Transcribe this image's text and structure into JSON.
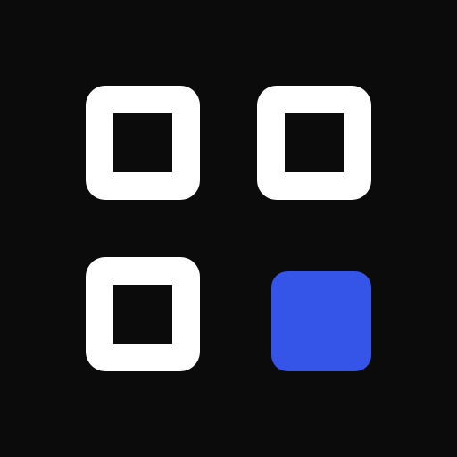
{
  "icon": {
    "name": "app-grid-icon",
    "colors": {
      "background": "#0b0b0c",
      "outline": "#ffffff",
      "accent": "#3554e8"
    },
    "tiles": [
      {
        "name": "tile-top-left",
        "style": "outline"
      },
      {
        "name": "tile-top-right",
        "style": "outline"
      },
      {
        "name": "tile-bottom-left",
        "style": "outline"
      },
      {
        "name": "tile-bottom-right",
        "style": "filled"
      }
    ]
  }
}
